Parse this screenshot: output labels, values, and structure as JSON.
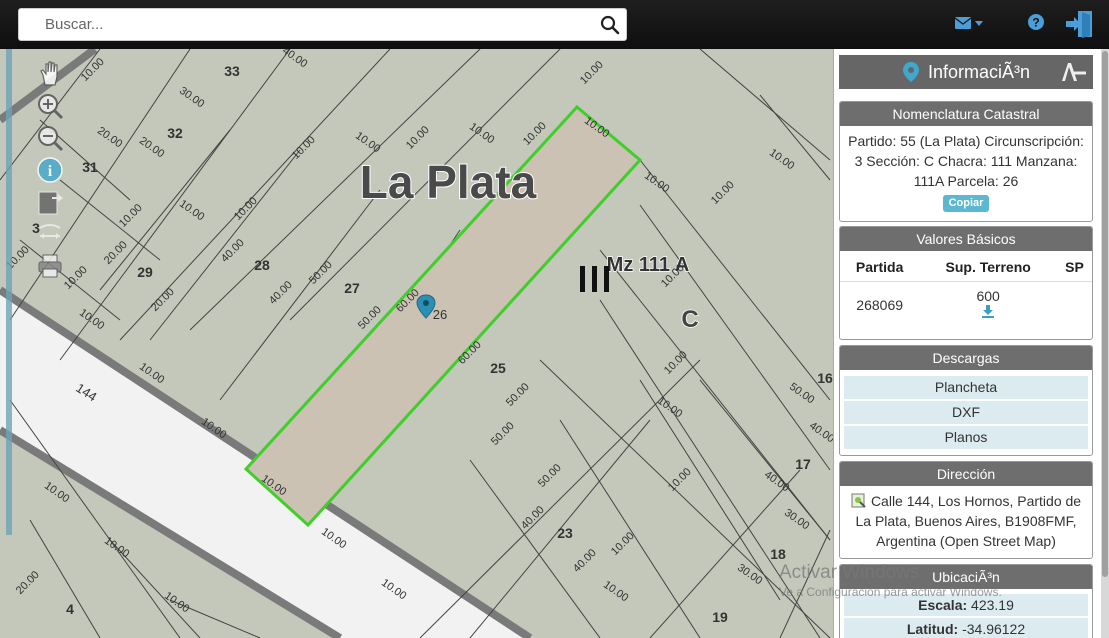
{
  "search": {
    "placeholder": "Buscar..."
  },
  "toolbar_icons": [
    "mail-icon",
    "help-icon",
    "logout-icon"
  ],
  "map": {
    "city_label": "La Plata",
    "block_label": "Mz 111 A",
    "section_letter": "C",
    "street_label": "144",
    "parcel_marker": "26",
    "parcel_numbers": [
      "33",
      "32",
      "31",
      "3",
      "29",
      "28",
      "27",
      "25",
      "23",
      "17",
      "18",
      "19",
      "16",
      "4"
    ],
    "dimension_labels": [
      "10.00",
      "20.00",
      "30.00",
      "40.00",
      "50.00",
      "60.00"
    ]
  },
  "map_tools": [
    "pan-icon",
    "zoom-in-icon",
    "zoom-out-icon",
    "info-icon",
    "export-icon",
    "measure-icon",
    "print-icon"
  ],
  "panel": {
    "title": "InformaciÃ³n",
    "nomenclatura": {
      "title": "Nomenclatura Catastral",
      "text": "Partido: 55 (La Plata) Circunscripción: 3 Sección: C Chacra: 111 Manzana: 111A Parcela: 26",
      "copy_label": "Copiar"
    },
    "valores": {
      "title": "Valores Básicos",
      "headers": [
        "Partida",
        "Sup. Terreno",
        "SP"
      ],
      "row": [
        "268069",
        "600",
        ""
      ]
    },
    "descargas": {
      "title": "Descargas",
      "items": [
        "Plancheta",
        "DXF",
        "Planos"
      ]
    },
    "direccion": {
      "title": "Dirección",
      "text": "Calle 144, Los Hornos, Partido de La Plata, Buenos Aires, B1908FMF, Argentina (Open Street Map)"
    },
    "ubicacion": {
      "title": "UbicaciÃ³n",
      "escala_label": "Escala:",
      "escala_value": "423.19",
      "latitud_label": "Latitud:",
      "latitud_value": "-34.96122"
    }
  },
  "watermark": {
    "line1": "Activar Windows",
    "line2": "Ve a Configuración para activar Windows."
  },
  "colors": {
    "map_bg": "#c3c8bb",
    "parcel_fill": "#cbc2b3",
    "parcel_outline": "#3fce2a",
    "panel_header": "#6e6e6e",
    "download_row": "#dcebf0",
    "copy_button": "#5bb8d0",
    "marker": "#2b8fb3"
  }
}
